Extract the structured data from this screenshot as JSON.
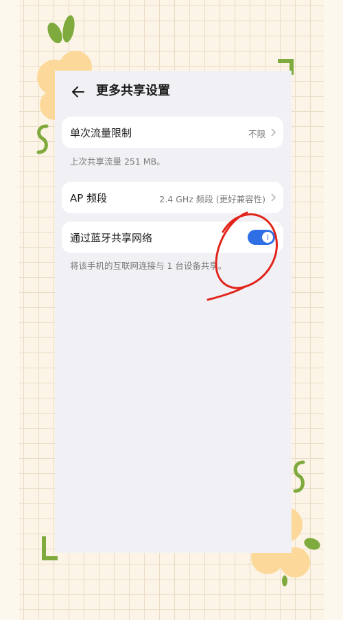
{
  "header": {
    "title": "更多共享设置"
  },
  "data_limit": {
    "label": "单次流量限制",
    "value": "不限"
  },
  "last_usage_hint": "上次共享流量 251 MB。",
  "ap_band": {
    "label": "AP 频段",
    "value": "2.4 GHz 频段 (更好兼容性)"
  },
  "bluetooth_share": {
    "label": "通过蓝牙共享网络",
    "enabled": true,
    "hint": "将该手机的互联网连接与 1 台设备共享。"
  },
  "colors": {
    "accent": "#2f6fe6",
    "scribble": "#e2231a",
    "card_bg": "#ffffff",
    "screen_bg": "#f1f1f5",
    "paper_bg": "#fcf4e6"
  },
  "icons": {
    "back": "back-arrow-icon",
    "chevron": "chevron-right-icon"
  }
}
